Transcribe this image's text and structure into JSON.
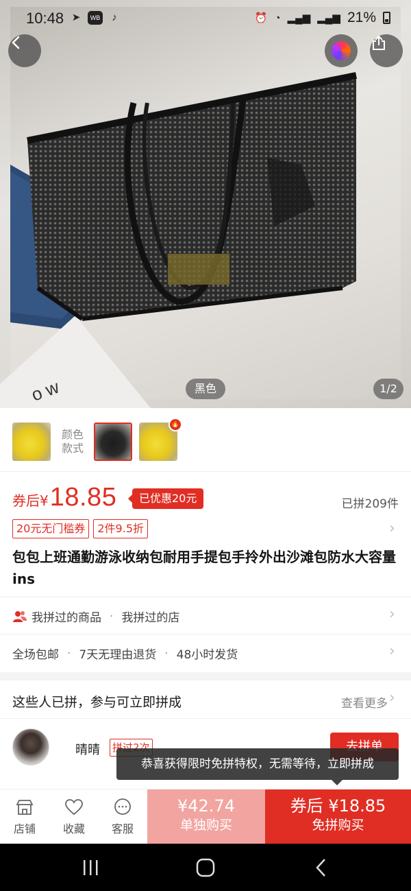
{
  "status_bar": {
    "time": "10:48",
    "icons_left": [
      "telegram-icon",
      "weibo-icon",
      "tiktok-icon"
    ],
    "weibo_badge": "WB",
    "battery_percent": "21%",
    "icons_right": [
      "alarm-icon",
      "wifi-icon",
      "signal-icon",
      "signal-icon",
      "battery-icon"
    ]
  },
  "gallery": {
    "color_tag": "黑色",
    "page_indicator": "1/2"
  },
  "variants": {
    "label": "颜色款式",
    "items": [
      {
        "color": "yellow",
        "selected": false
      },
      {
        "color": "black",
        "selected": true
      },
      {
        "color": "yellow",
        "selected": false,
        "hot": true
      }
    ]
  },
  "price": {
    "prefix": "券后¥",
    "value": "18.85",
    "discount_badge": "已优惠20元",
    "grouped_count": "已拼209件"
  },
  "coupons": [
    "20元无门槛券",
    "2件9.5折"
  ],
  "product_title": "包包上班通勤游泳收纳包耐用手提包手拎外出沙滩包防水大容量ins",
  "history_row": {
    "items": [
      "我拼过的商品",
      "我拼过的店"
    ]
  },
  "service_row": {
    "items": [
      "全场包邮",
      "7天无理由退货",
      "48小时发货"
    ]
  },
  "group_section": {
    "title": "这些人已拼，参与可立即拼成",
    "more": "查看更多",
    "user": {
      "name": "晴晴",
      "badge": "拼过2次",
      "button": "去拼单"
    },
    "tooltip": "恭喜获得限时免拼特权，无需等待，立即拼成"
  },
  "bottom_bar": {
    "store": "店铺",
    "favorite": "收藏",
    "service": "客服",
    "alone_price": "¥42.74",
    "alone_label": "单独购买",
    "buy_price": "券后 ¥18.85",
    "buy_label": "免拼购买"
  },
  "colors": {
    "accent": "#e02e24",
    "alone_button": "#f2a5a0"
  }
}
